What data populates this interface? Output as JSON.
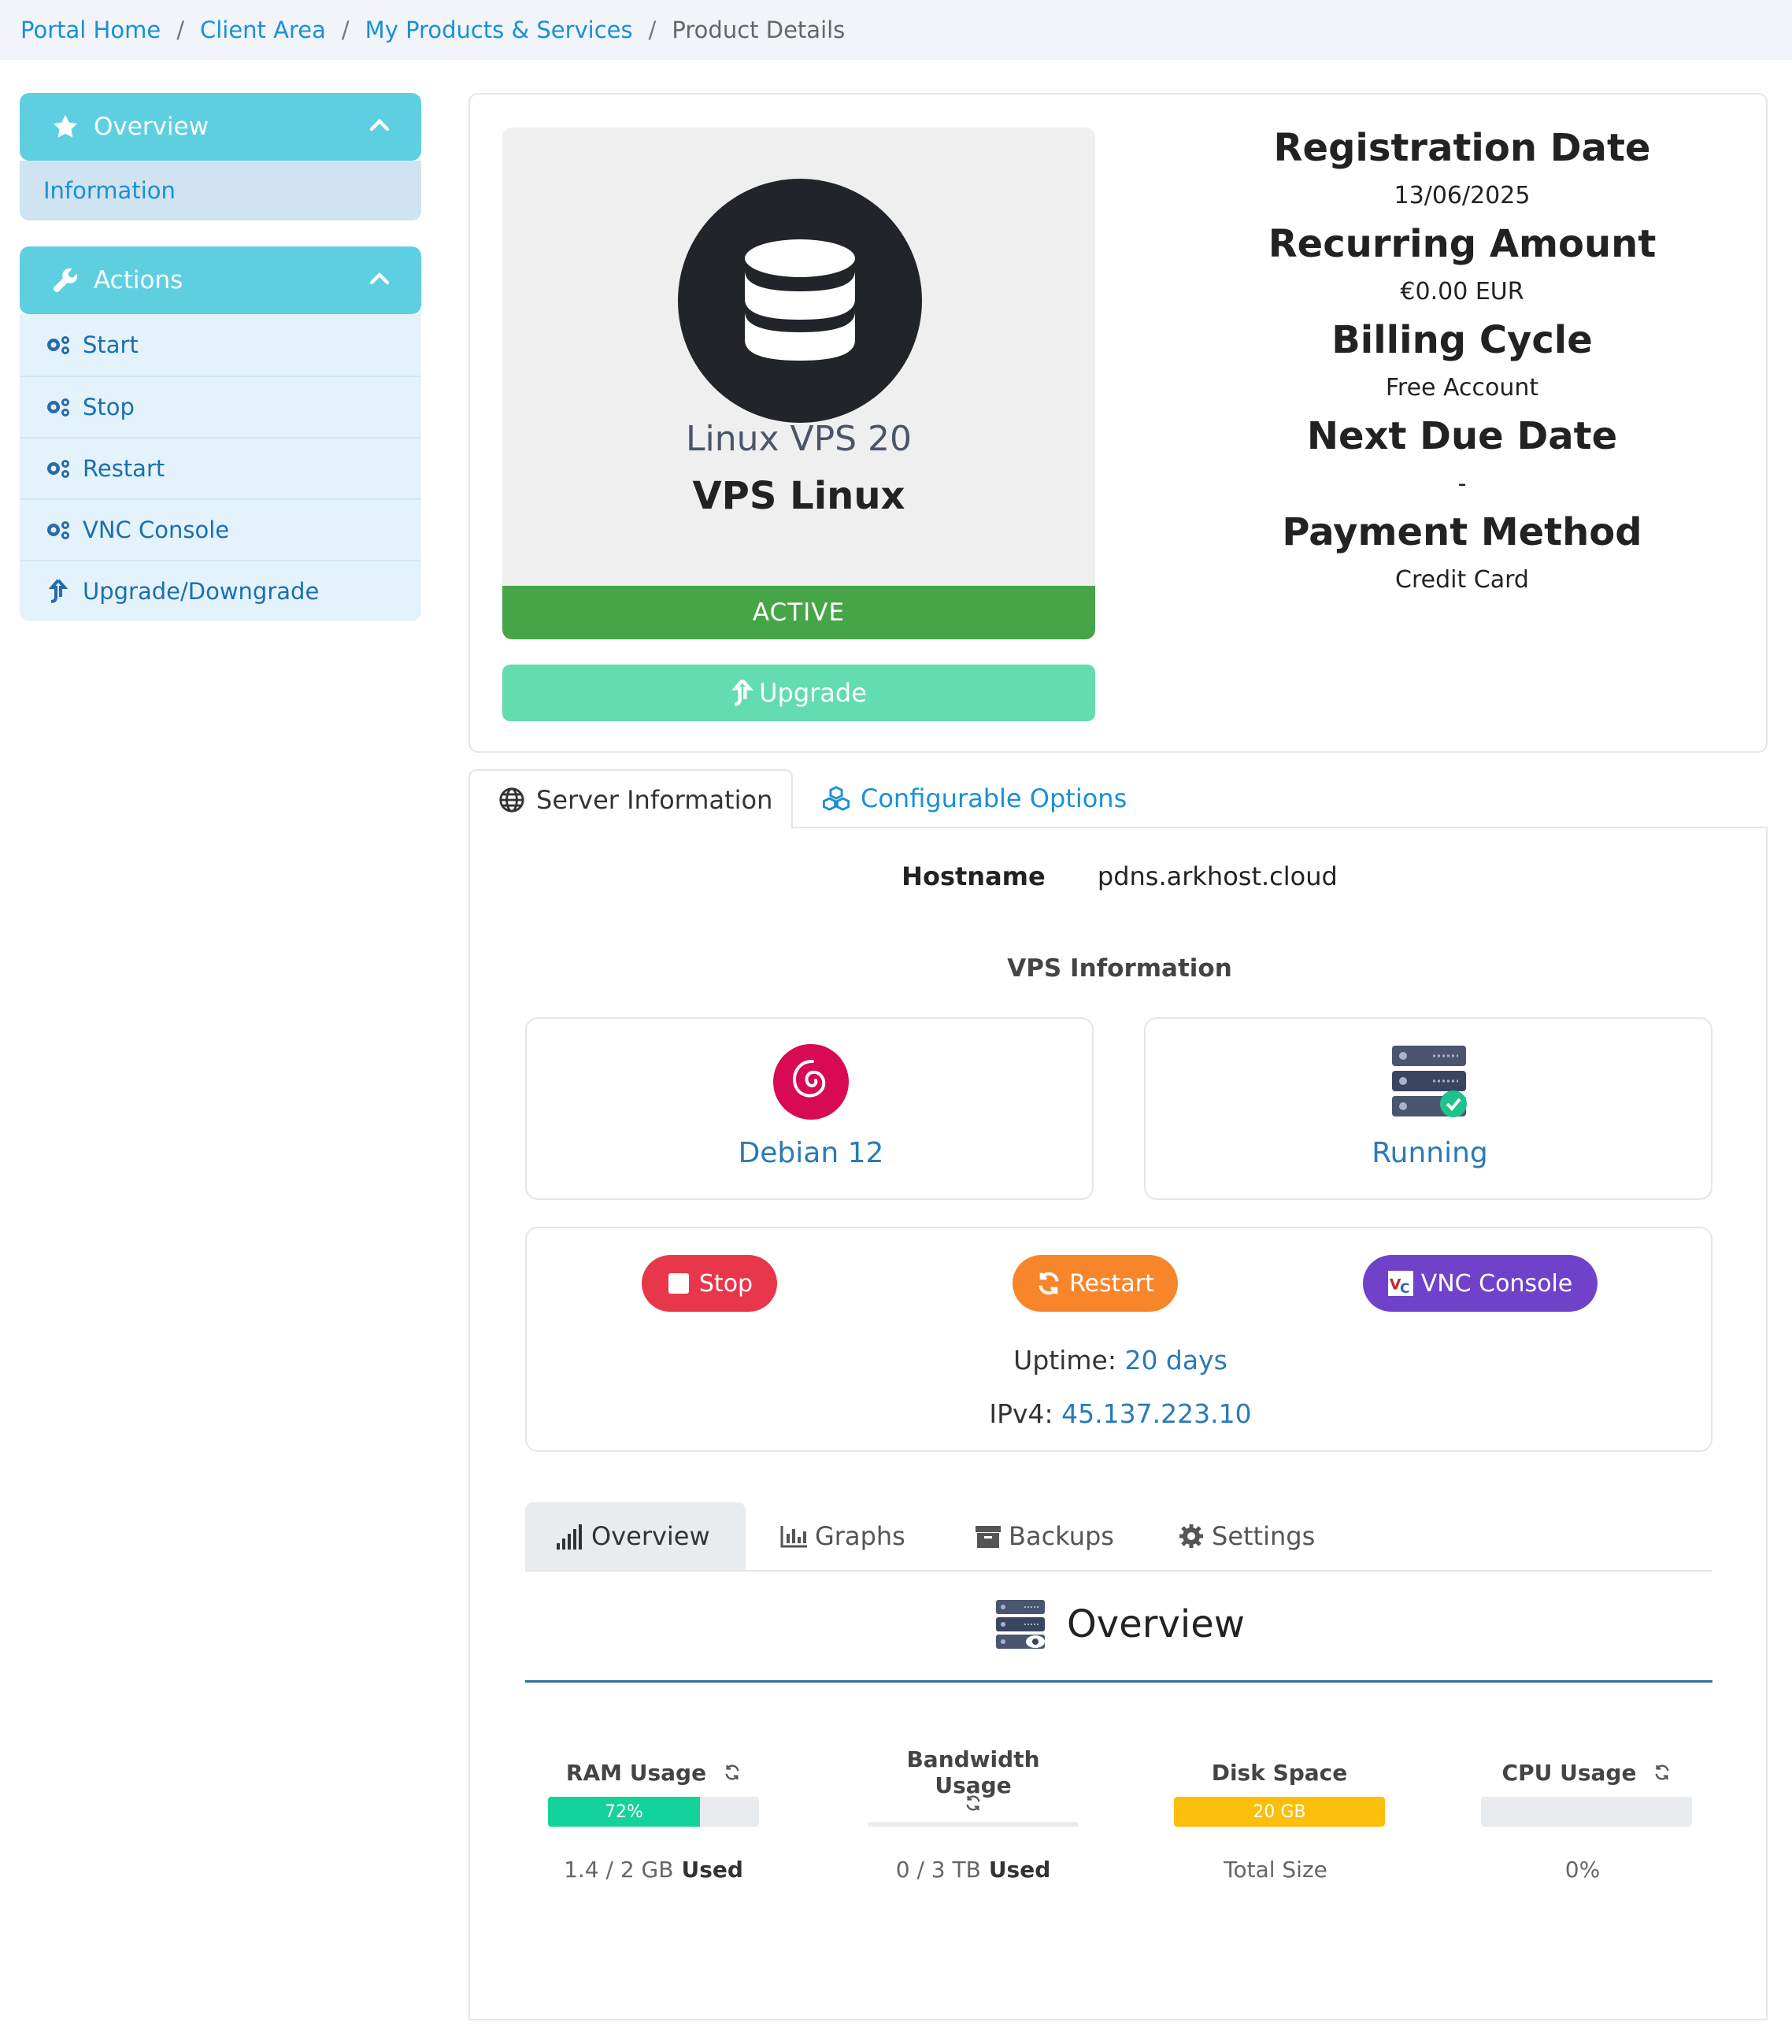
{
  "breadcrumb": {
    "items": [
      "Portal Home",
      "Client Area",
      "My Products & Services"
    ],
    "current": "Product Details",
    "separator": "/"
  },
  "sidebar": {
    "overview": {
      "title": "Overview",
      "items": [
        "Information"
      ]
    },
    "actions": {
      "title": "Actions",
      "items": [
        "Start",
        "Stop",
        "Restart",
        "VNC Console",
        "Upgrade/Downgrade"
      ]
    }
  },
  "product": {
    "group": "Linux VPS 20",
    "name": "VPS Linux",
    "status": "ACTIVE",
    "upgrade_label": "Upgrade"
  },
  "details": {
    "registration_label": "Registration Date",
    "registration_value": "13/06/2025",
    "recurring_label": "Recurring Amount",
    "recurring_value": "€0.00 EUR",
    "billing_label": "Billing Cycle",
    "billing_value": "Free Account",
    "nextdue_label": "Next Due Date",
    "nextdue_value": "-",
    "payment_label": "Payment Method",
    "payment_value": "Credit Card"
  },
  "tabs": {
    "server_info": "Server Information",
    "config_options": "Configurable Options"
  },
  "server": {
    "hostname_label": "Hostname",
    "hostname_value": "pdns.arkhost.cloud",
    "vps_info_title": "VPS Information",
    "os": "Debian 12",
    "state": "Running",
    "stop_label": "Stop",
    "restart_label": "Restart",
    "vnc_label": "VNC Console",
    "uptime_label": "Uptime:",
    "uptime_value": "20 days",
    "ipv4_label": "IPv4:",
    "ipv4_value": "45.137.223.10"
  },
  "subtabs": [
    "Overview",
    "Graphs",
    "Backups",
    "Settings"
  ],
  "overview": {
    "title": "Overview",
    "stats": [
      {
        "title": "RAM Usage",
        "bar_label": "72%",
        "percent": 72,
        "color": "#14d39a",
        "value": "1.4 / 2 GB",
        "suffix": "Used"
      },
      {
        "title": "Bandwidth Usage",
        "bar_label": "",
        "percent": 0,
        "color": "#14d39a",
        "value": "0 / 3 TB",
        "suffix": "Used"
      },
      {
        "title": "Disk Space",
        "bar_label": "20 GB",
        "percent": 100,
        "color": "#fbbf0a",
        "value": "Total Size",
        "suffix": ""
      },
      {
        "title": "CPU Usage",
        "bar_label": "",
        "percent": 0,
        "color": "#14d39a",
        "value": "0%",
        "suffix": ""
      }
    ]
  },
  "colors": {
    "accent": "#1a8fd6",
    "panel_head": "#5ecfe0",
    "active_green": "#46a546",
    "upgrade": "#63dcb0",
    "stop": "#e8374a",
    "restart": "#f7862b",
    "vnc": "#7042c9"
  },
  "icons": [
    "star-icon",
    "chevron-up-icon",
    "wrench-icon",
    "cogs-icon",
    "arrow-up-icon",
    "database-icon",
    "globe-icon",
    "cubes-icon",
    "debian-icon",
    "server-check-icon",
    "stop-icon",
    "refresh-icon",
    "vnc-icon",
    "signal-icon",
    "chart-icon",
    "archive-icon",
    "gear-icon",
    "server-eye-icon"
  ]
}
